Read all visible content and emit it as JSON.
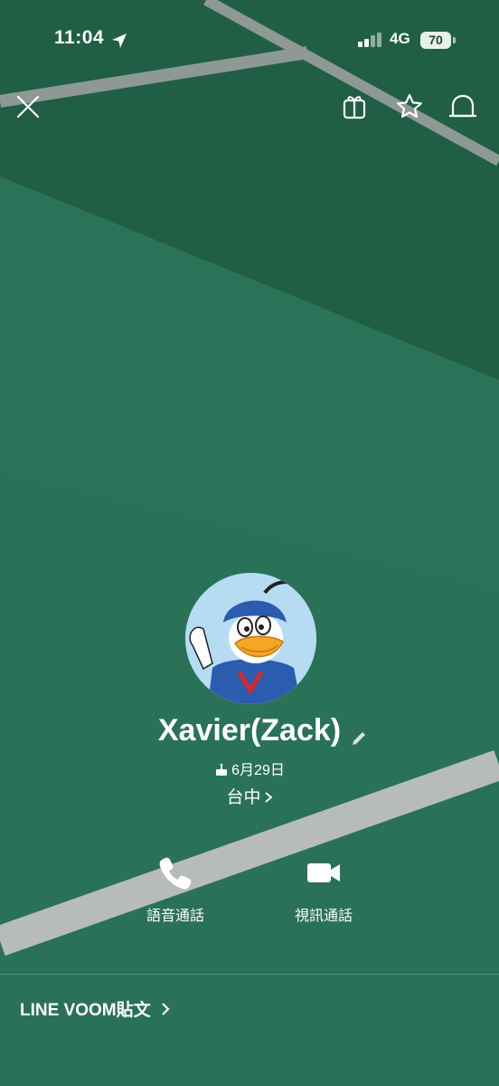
{
  "status_bar": {
    "time": "11:04",
    "network": "4G",
    "battery": "70",
    "location_icon": "location-arrow-icon",
    "signal_icon": "signal-bars-icon"
  },
  "top_bar": {
    "close_icon": "close-icon",
    "gift_icon": "gift-icon",
    "favorite_icon": "star-icon",
    "notification_icon": "bell-icon"
  },
  "profile": {
    "name": "Xavier(Zack)",
    "birthday": "6月29日",
    "location": "台中",
    "edit_icon": "pencil-icon",
    "birthday_icon": "cake-icon"
  },
  "actions": {
    "voice_call": "語音通話",
    "video_call": "視訊通話"
  },
  "footer": {
    "voom_posts": "LINE VOOM貼文"
  },
  "colors": {
    "background_primary": "#2a7257",
    "background_dark": "#1f5f45",
    "court_line": "#9aa39e",
    "text": "#ffffff"
  }
}
